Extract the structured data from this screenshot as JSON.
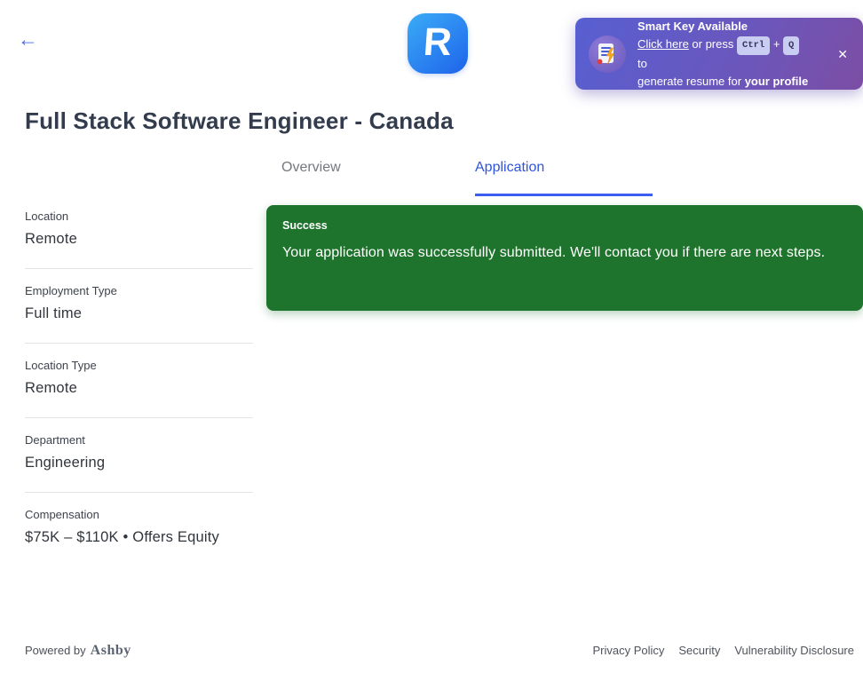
{
  "header": {
    "back_icon": "←",
    "logo_letter": "R",
    "toast": {
      "title": "Smart Key Available",
      "link_text": "Click here",
      "after_link": " or press ",
      "key1": "Ctrl",
      "plus": "+",
      "key2": "Q",
      "after_keys": " to",
      "line2_prefix": "generate resume for ",
      "line2_bold": "your profile",
      "close_icon": "✕"
    }
  },
  "page": {
    "title": "Full Stack Software Engineer - Canada"
  },
  "tabs": [
    {
      "label": "Overview",
      "active": false
    },
    {
      "label": "Application",
      "active": true
    }
  ],
  "details": [
    {
      "label": "Location",
      "value": "Remote"
    },
    {
      "label": "Employment Type",
      "value": "Full time"
    },
    {
      "label": "Location Type",
      "value": "Remote"
    },
    {
      "label": "Department",
      "value": "Engineering"
    },
    {
      "label": "Compensation",
      "value": "$75K – $110K • Offers Equity"
    }
  ],
  "banner": {
    "title": "Success",
    "message": "Your application was successfully submitted. We'll contact you if there are next steps."
  },
  "footer": {
    "powered_by": "Powered by",
    "brand": "Ashby",
    "links": [
      "Privacy Policy",
      "Security",
      "Vulnerability Disclosure"
    ]
  },
  "colors": {
    "accent_blue": "#2e55dd",
    "tab_underline": "#3b5ef0",
    "success_green": "#1e742c",
    "toast_gradient_start": "#575fd1",
    "toast_gradient_end": "#7c4ea4",
    "logo_gradient_start": "#3aacf6",
    "logo_gradient_end": "#1f63ea"
  }
}
